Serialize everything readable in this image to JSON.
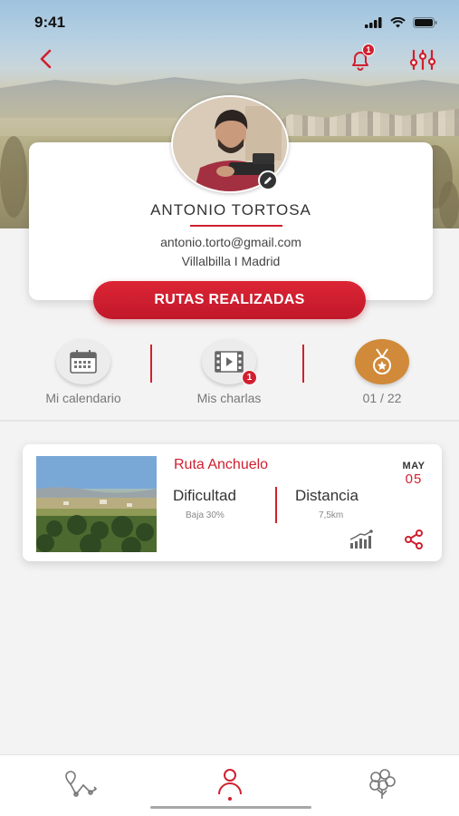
{
  "status_bar": {
    "time": "9:41"
  },
  "header": {
    "back_icon": "chevron-left-icon",
    "notifications": {
      "icon": "bell-icon",
      "badge": "1"
    },
    "filter_icon": "sliders-icon"
  },
  "profile": {
    "name": "ANTONIO TORTOSA",
    "email": "antonio.torto@gmail.com",
    "location": "Villalbilla I Madrid",
    "edit_icon": "pencil-icon"
  },
  "primary_button": {
    "label": "RUTAS REALIZADAS"
  },
  "quick_links": [
    {
      "label": "Mi calendario",
      "icon": "calendar-icon"
    },
    {
      "label": "Mis charlas",
      "icon": "film-icon",
      "badge": "1"
    },
    {
      "label": "01 / 22",
      "icon": "medal-icon"
    }
  ],
  "route": {
    "title": "Ruta Anchuelo",
    "month": "MAY",
    "day": "05",
    "difficulty_label": "Dificultad",
    "difficulty_value": "Baja 30%",
    "distance_label": "Distancia",
    "distance_value": "7,5km",
    "actions": [
      "elevation-chart-icon",
      "share-icon"
    ]
  },
  "bottom_nav": [
    {
      "icon": "route-map-icon",
      "active": false
    },
    {
      "icon": "profile-icon",
      "active": true
    },
    {
      "icon": "tree-icon",
      "active": false
    }
  ],
  "colors": {
    "accent": "#d0202f",
    "gold": "#d08a3a"
  }
}
